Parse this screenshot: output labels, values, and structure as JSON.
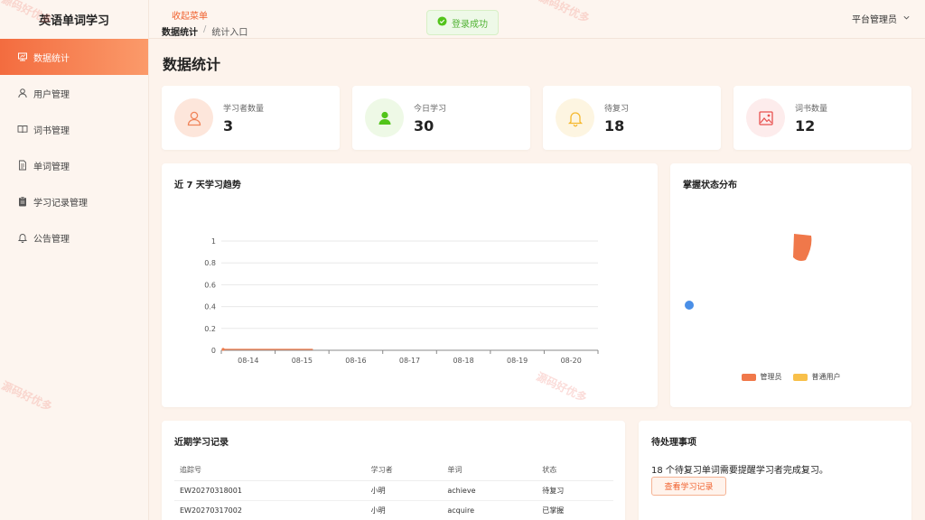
{
  "app": {
    "title": "英语单词学习"
  },
  "sidebar": {
    "items": [
      {
        "label": "数据统计",
        "icon": "chart-icon",
        "active": true
      },
      {
        "label": "用户管理",
        "icon": "user-icon"
      },
      {
        "label": "词书管理",
        "icon": "book-icon"
      },
      {
        "label": "单词管理",
        "icon": "document-icon"
      },
      {
        "label": "学习记录管理",
        "icon": "clipboard-icon"
      },
      {
        "label": "公告管理",
        "icon": "bell-icon"
      }
    ]
  },
  "header": {
    "collapse_label": "收起菜单",
    "breadcrumb": [
      "数据统计",
      "/",
      "统计入口"
    ],
    "user": "平台管理员",
    "toast": "登录成功"
  },
  "page": {
    "title": "数据统计"
  },
  "stats": [
    {
      "label": "学习者数量",
      "value": "3",
      "icon": "user-icon",
      "color": "#f0845a",
      "bg": "#fde6db"
    },
    {
      "label": "今日学习",
      "value": "30",
      "icon": "person-icon",
      "color": "#52c41a",
      "bg": "#eef9e6"
    },
    {
      "label": "待复习",
      "value": "18",
      "icon": "bell-icon",
      "color": "#f5b82e",
      "bg": "#fdf5e1"
    },
    {
      "label": "词书数量",
      "value": "12",
      "icon": "image-icon",
      "color": "#e8514f",
      "bg": "#fdecec"
    }
  ],
  "trend": {
    "title": "近 7 天学习趋势"
  },
  "chart_data": [
    {
      "type": "line",
      "x": [
        "08-14",
        "08-15",
        "08-16",
        "08-17",
        "08-18",
        "08-19",
        "08-20"
      ],
      "series": [
        {
          "name": "",
          "values": [
            0,
            0,
            null,
            null,
            null,
            null,
            null
          ],
          "color": "#f07a4a"
        }
      ],
      "ylim": [
        0,
        1
      ],
      "yticks": [
        "0",
        "0.2",
        "0.4",
        "0.6",
        "0.8",
        "1"
      ],
      "grid": true
    },
    {
      "type": "pie",
      "title": "掌握状态分布",
      "series": [
        {
          "name": "管理员",
          "color": "#f0784a"
        },
        {
          "name": "普通用户",
          "color": "#f8c04a"
        }
      ],
      "legend_position": "bottom"
    }
  ],
  "records": {
    "title": "近期学习记录",
    "columns": [
      "追踪号",
      "学习者",
      "单词",
      "状态"
    ],
    "rows": [
      [
        "EW20270318001",
        "小明",
        "achieve",
        "待复习"
      ],
      [
        "EW20270317002",
        "小明",
        "acquire",
        "已掌握"
      ]
    ]
  },
  "todo": {
    "title": "待处理事项",
    "text": "18 个待复习单词需要提醒学习者完成复习。",
    "button": "查看学习记录"
  },
  "watermark": "源码好优多"
}
